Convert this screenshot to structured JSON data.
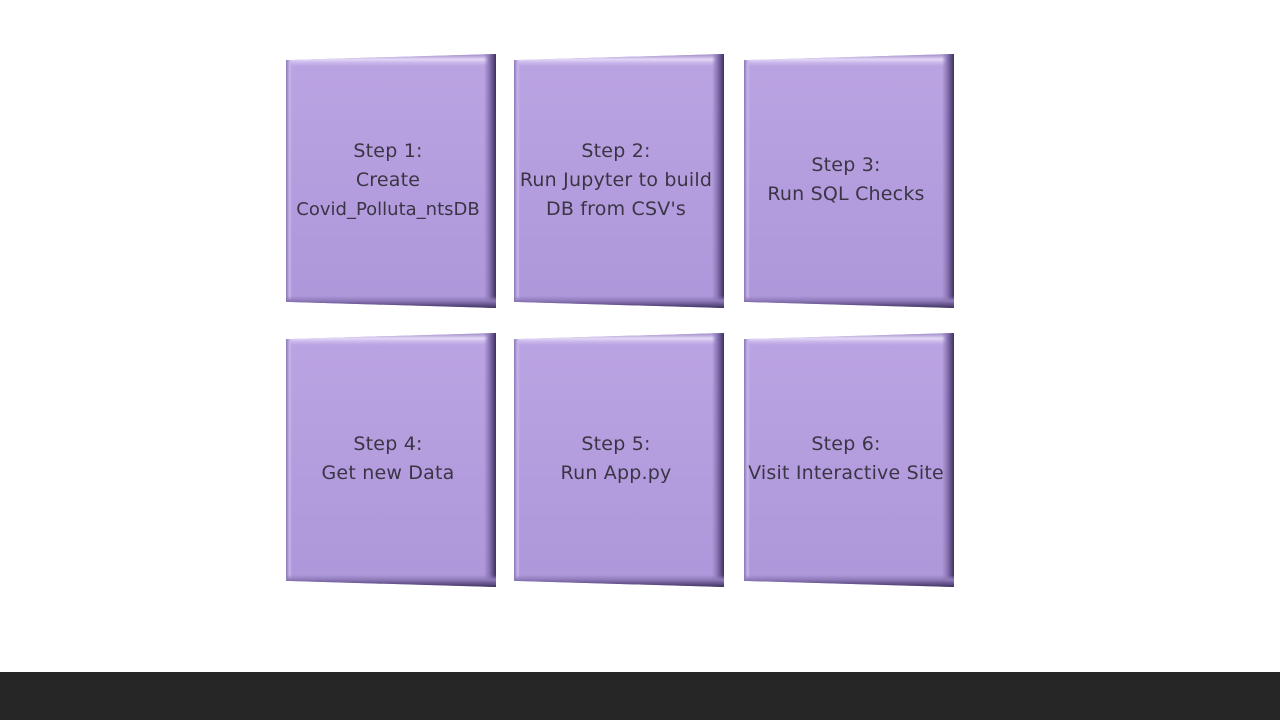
{
  "steps": [
    {
      "lines": [
        "Step 1:",
        "Create",
        "Covid_Polluta_ntsDB"
      ]
    },
    {
      "lines": [
        "Step 2:",
        "Run Jupyter to build",
        "DB from CSV's"
      ]
    },
    {
      "lines": [
        "Step 3:",
        "Run SQL Checks"
      ]
    },
    {
      "lines": [
        "Step 4:",
        "Get new Data"
      ]
    },
    {
      "lines": [
        "Step 5:",
        "Run App.py"
      ]
    },
    {
      "lines": [
        "Step 6:",
        "Visit Interactive Site"
      ]
    }
  ],
  "colors": {
    "tile_fill": "#b39ddf",
    "tile_text": "#3a3545",
    "bottom_bar": "#262626",
    "background": "#ffffff"
  }
}
